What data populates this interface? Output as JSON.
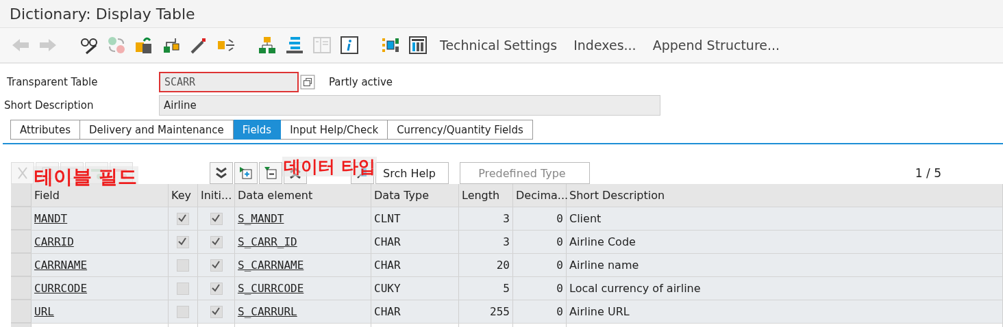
{
  "window": {
    "title": "Dictionary: Display Table"
  },
  "toolbar": {
    "buttons": [
      "Technical Settings",
      "Indexes...",
      "Append Structure..."
    ]
  },
  "header": {
    "table_label": "Transparent Table",
    "table_name": "SCARR",
    "status": "Partly active",
    "description_label": "Short Description",
    "description": "Airline"
  },
  "tabs": [
    {
      "label": "Attributes",
      "selected": false
    },
    {
      "label": "Delivery and Maintenance",
      "selected": false
    },
    {
      "label": "Fields",
      "selected": true
    },
    {
      "label": "Input Help/Check",
      "selected": false
    },
    {
      "label": "Currency/Quantity Fields",
      "selected": false
    }
  ],
  "field_toolbar": {
    "srch_help": "Srch Help",
    "predefined_type": "Predefined Type",
    "pager": "1 / 5"
  },
  "annotations": [
    "테이블 필드",
    "데이터 타입"
  ],
  "table": {
    "columns": [
      "Field",
      "Key",
      "Initi...",
      "Data element",
      "Data Type",
      "Length",
      "Decima...",
      "Short Description"
    ],
    "rows": [
      {
        "field": "MANDT",
        "key": true,
        "initial": true,
        "data_element": "S_MANDT",
        "data_type": "CLNT",
        "length": "3",
        "decimals": "0",
        "description": "Client"
      },
      {
        "field": "CARRID",
        "key": true,
        "initial": true,
        "data_element": "S_CARR_ID",
        "data_type": "CHAR",
        "length": "3",
        "decimals": "0",
        "description": "Airline Code"
      },
      {
        "field": "CARRNAME",
        "key": false,
        "initial": true,
        "data_element": "S_CARRNAME",
        "data_type": "CHAR",
        "length": "20",
        "decimals": "0",
        "description": "Airline name"
      },
      {
        "field": "CURRCODE",
        "key": false,
        "initial": true,
        "data_element": "S_CURRCODE",
        "data_type": "CUKY",
        "length": "5",
        "decimals": "0",
        "description": "Local currency of airline"
      },
      {
        "field": "URL",
        "key": false,
        "initial": true,
        "data_element": "S_CARRURL",
        "data_type": "CHAR",
        "length": "255",
        "decimals": "0",
        "description": "Airline URL"
      }
    ]
  }
}
